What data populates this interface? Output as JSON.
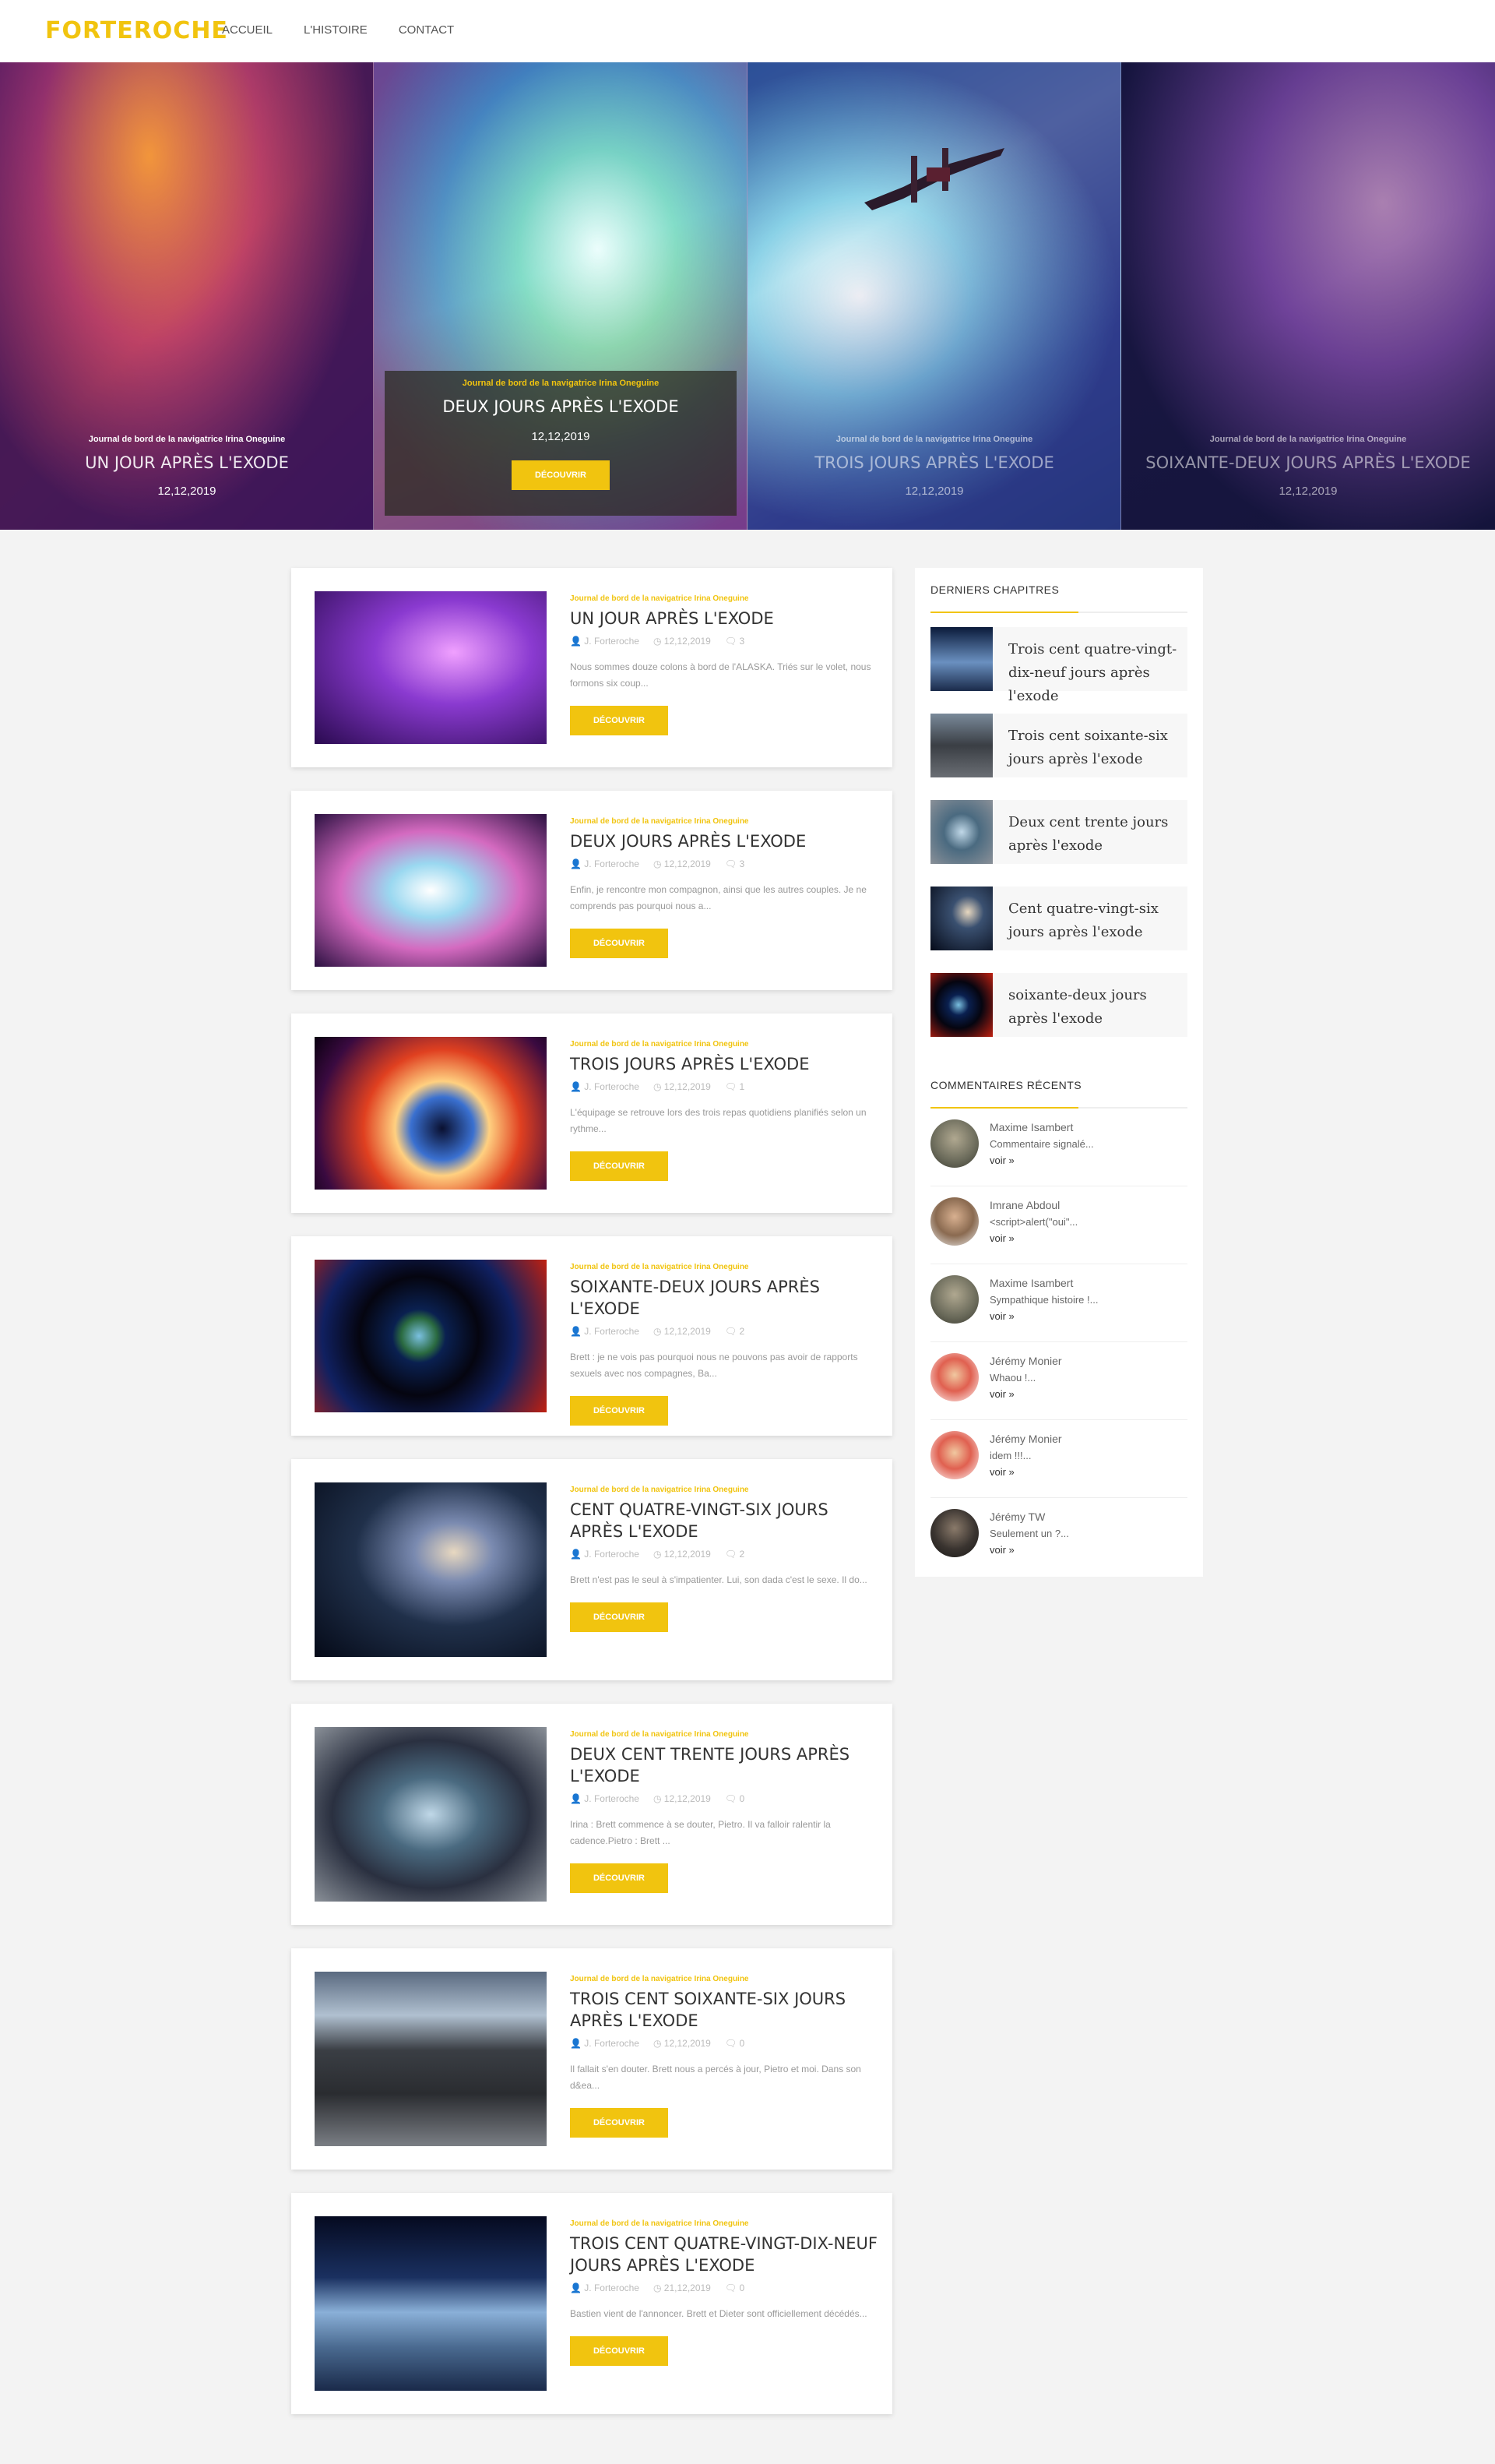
{
  "header": {
    "logo": "FORTEROCHE",
    "nav": [
      "ACCUEIL",
      "L'HISTOIRE",
      "CONTACT"
    ]
  },
  "slides": [
    {
      "category": "Journal de bord de la navigatrice Irina Oneguine",
      "title": "UN JOUR APRÈS L'EXODE",
      "date": "12,12,2019"
    },
    {
      "category": "Journal de bord de la navigatrice Irina Oneguine",
      "title": "DEUX JOURS APRÈS L'EXODE",
      "date": "12,12,2019",
      "button": "DÉCOUVRIR"
    },
    {
      "category": "Journal de bord de la navigatrice Irina Oneguine",
      "title": "TROIS JOURS APRÈS L'EXODE",
      "date": "12,12,2019"
    },
    {
      "category": "Journal de bord de la navigatrice Irina Oneguine",
      "title": "SOIXANTE-DEUX JOURS APRÈS L'EXODE",
      "date": "12,12,2019"
    }
  ],
  "posts": [
    {
      "category": "Journal de bord de la navigatrice Irina Oneguine",
      "title": "UN JOUR APRÈS L'EXODE",
      "author": "J. Forteroche",
      "date": "12,12,2019",
      "comments": "3",
      "excerpt": "Nous sommes douze colons à bord de l'ALASKA. Triés sur le volet, nous formons six coup...",
      "button": "DÉCOUVRIR"
    },
    {
      "category": "Journal de bord de la navigatrice Irina Oneguine",
      "title": "DEUX JOURS APRÈS L'EXODE",
      "author": "J. Forteroche",
      "date": "12,12,2019",
      "comments": "3",
      "excerpt": "Enfin, je rencontre mon compagnon, ainsi que les autres couples. Je ne comprends pas pourquoi nous a...",
      "button": "DÉCOUVRIR"
    },
    {
      "category": "Journal de bord de la navigatrice Irina Oneguine",
      "title": "TROIS JOURS APRÈS L'EXODE",
      "author": "J. Forteroche",
      "date": "12,12,2019",
      "comments": "1",
      "excerpt": "L'équipage se retrouve lors des trois repas quotidiens planifiés selon un rythme...",
      "button": "DÉCOUVRIR"
    },
    {
      "category": "Journal de bord de la navigatrice Irina Oneguine",
      "title": "SOIXANTE-DEUX JOURS APRÈS L'EXODE",
      "author": "J. Forteroche",
      "date": "12,12,2019",
      "comments": "2",
      "excerpt": "Brett : je ne vois pas pourquoi nous ne pouvons pas avoir de rapports sexuels avec nos compagnes, Ba...",
      "button": "DÉCOUVRIR"
    },
    {
      "category": "Journal de bord de la navigatrice Irina Oneguine",
      "title": "CENT QUATRE-VINGT-SIX JOURS APRÈS L'EXODE",
      "author": "J. Forteroche",
      "date": "12,12,2019",
      "comments": "2",
      "excerpt": "Brett n'est pas le seul à s'impatienter. Lui, son dada c'est le sexe. Il do...",
      "button": "DÉCOUVRIR"
    },
    {
      "category": "Journal de bord de la navigatrice Irina Oneguine",
      "title": "DEUX CENT TRENTE JOURS APRÈS L'EXODE",
      "author": "J. Forteroche",
      "date": "12,12,2019",
      "comments": "0",
      "excerpt": "Irina : Brett commence à se douter, Pietro. Il va falloir ralentir la cadence.Pietro : Brett ...",
      "button": "DÉCOUVRIR"
    },
    {
      "category": "Journal de bord de la navigatrice Irina Oneguine",
      "title": "TROIS CENT SOIXANTE-SIX JOURS APRÈS L'EXODE",
      "author": "J. Forteroche",
      "date": "12,12,2019",
      "comments": "0",
      "excerpt": "Il fallait s'en douter. Brett nous a percés à jour, Pietro et moi. Dans son d&ea...",
      "button": "DÉCOUVRIR"
    },
    {
      "category": "Journal de bord de la navigatrice Irina Oneguine",
      "title": "TROIS CENT QUATRE-VINGT-DIX-NEUF JOURS APRÈS L'EXODE",
      "author": "J. Forteroche",
      "date": "21,12,2019",
      "comments": "0",
      "excerpt": "Bastien vient de l'annoncer. Brett et Dieter sont officiellement décédés...",
      "button": "DÉCOUVRIR"
    }
  ],
  "sidebar": {
    "chapters_title": "DERNIERS CHAPITRES",
    "chapters": [
      "Trois cent quatre-vingt-dix-neuf jours après l'exode",
      "Trois cent soixante-six jours après l'exode",
      "Deux cent trente jours après l'exode",
      "Cent quatre-vingt-six jours après l'exode",
      "soixante-deux jours après l'exode"
    ],
    "comments_title": "COMMENTAIRES RÉCENTS",
    "comments": [
      {
        "author": "Maxime Isambert",
        "text": "Commentaire signalé...",
        "link": "voir »"
      },
      {
        "author": "Imrane Abdoul",
        "text": "<script>alert(\"oui\"...",
        "link": "voir »"
      },
      {
        "author": "Maxime Isambert",
        "text": "Sympathique histoire !...",
        "link": "voir »"
      },
      {
        "author": "Jérémy Monier",
        "text": "Whaou !...",
        "link": "voir »"
      },
      {
        "author": "Jérémy Monier",
        "text": "idem !!!...",
        "link": "voir »"
      },
      {
        "author": "Jérémy TW",
        "text": "Seulement un ?...",
        "link": "voir »"
      }
    ]
  },
  "colors": {
    "accent": "#f1c40f",
    "background": "#f3f3f3"
  },
  "icons": {
    "author": "user-icon",
    "date": "clock-icon",
    "comments": "comment-icon"
  }
}
